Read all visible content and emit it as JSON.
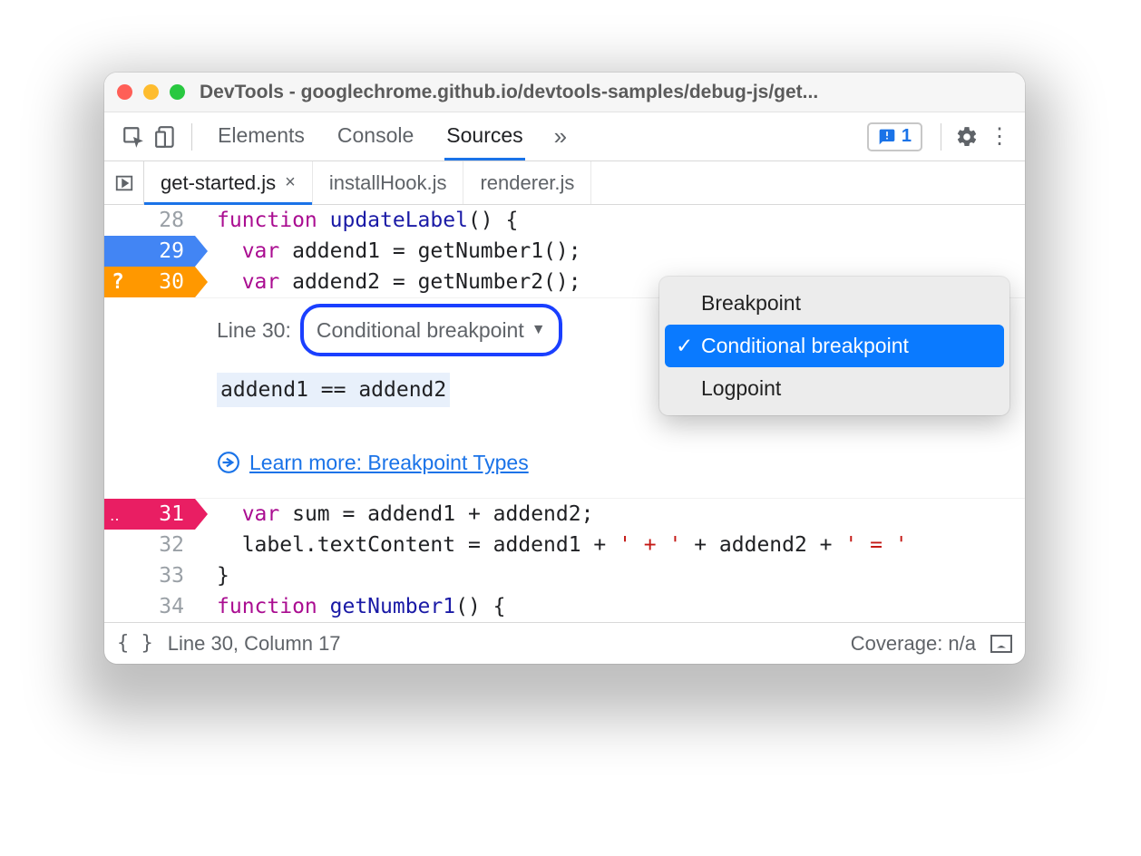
{
  "window": {
    "title": "DevTools - googlechrome.github.io/devtools-samples/debug-js/get..."
  },
  "toolbar": {
    "tabs": [
      "Elements",
      "Console",
      "Sources"
    ],
    "active_tab": "Sources",
    "issues_count": "1"
  },
  "file_tabs": {
    "items": [
      {
        "name": "get-started.js",
        "active": true
      },
      {
        "name": "installHook.js",
        "active": false
      },
      {
        "name": "renderer.js",
        "active": false
      }
    ]
  },
  "code": {
    "lines": [
      {
        "num": "28",
        "bp": null
      },
      {
        "num": "29",
        "bp": "blue"
      },
      {
        "num": "30",
        "bp": "orange"
      },
      {
        "num": "31",
        "bp": "pink"
      },
      {
        "num": "32",
        "bp": null
      },
      {
        "num": "33",
        "bp": null
      },
      {
        "num": "34",
        "bp": null
      }
    ],
    "l28_kw": "function",
    "l28_fn": " updateLabel",
    "l28_rest": "() {",
    "l29_kw": "var",
    "l29_rest": " addend1 = getNumber1();",
    "l30_kw": "var",
    "l30_rest": " addend2 = getNumber2();",
    "l31_kw": "var",
    "l31_rest": " sum = addend1 + addend2;",
    "l32_text": "  label.textContent = addend1 + ",
    "l32_str1": "' + '",
    "l32_mid": " + addend2 + ",
    "l32_str2": "' = '",
    "l33_text": "}",
    "l34_kw": "function",
    "l34_fn": " getNumber1",
    "l34_rest": "() {"
  },
  "bp_editor": {
    "line_label": "Line 30:",
    "type_label": "Conditional breakpoint",
    "expression": "addend1 == addend2",
    "learn_text": "Learn more: Breakpoint Types"
  },
  "dropdown": {
    "items": [
      "Breakpoint",
      "Conditional breakpoint",
      "Logpoint"
    ],
    "selected": "Conditional breakpoint"
  },
  "footer": {
    "position": "Line 30, Column 17",
    "coverage": "Coverage: n/a"
  }
}
